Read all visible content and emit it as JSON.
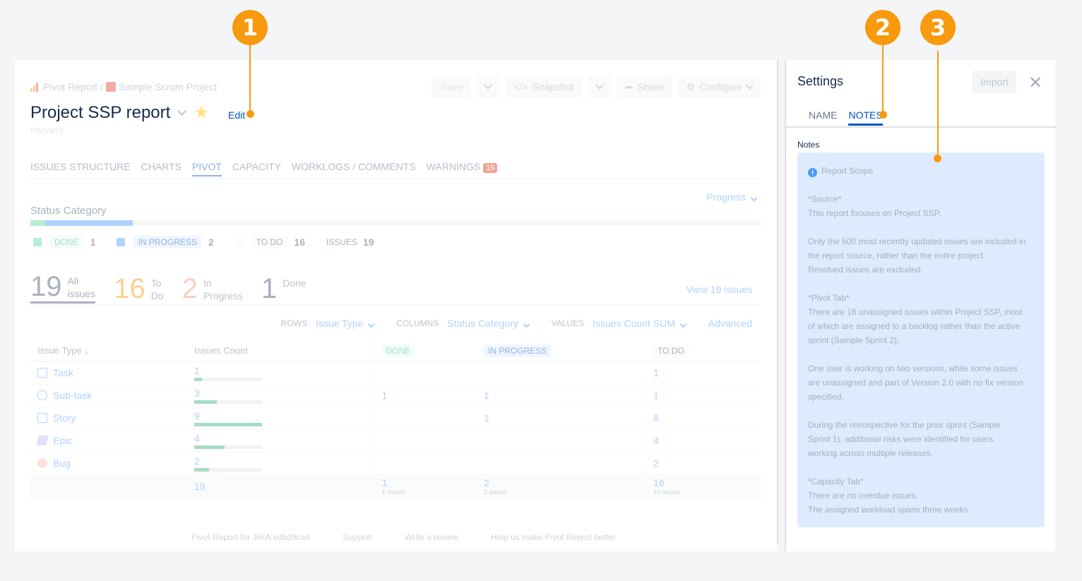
{
  "callouts": [
    "1",
    "2",
    "3"
  ],
  "breadcrumb": {
    "app": "Pivot Report",
    "sep": "/",
    "project": "Sample Scrum Project"
  },
  "toolbar": {
    "save": "Save",
    "snapshot": "Snapshot",
    "share": "Share",
    "configure": "Configure"
  },
  "report": {
    "title": "Project SSP report",
    "edit": "Edit",
    "visibility": "PRIVATE"
  },
  "tabs": [
    {
      "label": "ISSUES STRUCTURE"
    },
    {
      "label": "CHARTS"
    },
    {
      "label": "PIVOT"
    },
    {
      "label": "CAPACITY"
    },
    {
      "label": "WORKLOGS / COMMENTS"
    },
    {
      "label": "WARNINGS",
      "badge": "19"
    }
  ],
  "status": {
    "dropdown": "Progress",
    "title": "Status Category",
    "done_fraction": 0.053,
    "in_progress_fraction": 0.105,
    "legend": [
      {
        "label": "DONE",
        "count": "1",
        "color": "#57d9a3"
      },
      {
        "label": "IN PROGRESS",
        "count": "2",
        "color": "#4c9aff"
      },
      {
        "label": "TO DO",
        "count": "16",
        "color": "#dfe1e6"
      }
    ],
    "issues_label": "ISSUES",
    "issues_count": "19"
  },
  "summary": [
    {
      "num": "19",
      "l1": "All",
      "l2": "issues",
      "color": "#42526e"
    },
    {
      "num": "16",
      "l1": "To",
      "l2": "Do",
      "color": "#f79a0e"
    },
    {
      "num": "2",
      "l1": "In",
      "l2": "Progress",
      "color": "#ff8f73"
    },
    {
      "num": "1",
      "l1": "Done",
      "l2": "",
      "color": "#42526e"
    }
  ],
  "view_link": "View 19 issues",
  "pivot": {
    "rows_label": "ROWS",
    "rows_value": "Issue Type",
    "columns_label": "COLUMNS",
    "columns_value": "Status Category",
    "values_label": "VALUES",
    "values_value": "Issues Count SUM",
    "advanced": "Advanced"
  },
  "table": {
    "headers": [
      "Issue Type",
      "Issues Count",
      "DONE",
      "IN PROGRESS",
      "TO DO"
    ],
    "rows": [
      {
        "type": "Task",
        "icon": "task-icon",
        "count": "1",
        "frac": 0.11,
        "done": "",
        "inprog": "",
        "todo": "1"
      },
      {
        "type": "Sub-task",
        "icon": "subtask-icon",
        "count": "3",
        "frac": 0.33,
        "done": "1",
        "inprog": "1",
        "todo": "1"
      },
      {
        "type": "Story",
        "icon": "story-icon",
        "count": "9",
        "frac": 1.0,
        "done": "",
        "inprog": "1",
        "todo": "8"
      },
      {
        "type": "Epic",
        "icon": "epic-icon",
        "count": "4",
        "frac": 0.45,
        "done": "",
        "inprog": "",
        "todo": "4"
      },
      {
        "type": "Bug",
        "icon": "bug-icon",
        "count": "2",
        "frac": 0.22,
        "done": "",
        "inprog": "",
        "todo": "2"
      }
    ],
    "total": {
      "count": "19",
      "done": "1",
      "done_sub": "1 issues",
      "inprog": "2",
      "inprog_sub": "2 issues",
      "todo": "16",
      "todo_sub": "16 issues"
    }
  },
  "footer": [
    "Pivot Report for JIRA edbd9ca4",
    "Support",
    "Write a review",
    "Help us make Pivot Report better"
  ],
  "settings": {
    "title": "Settings",
    "import": "Import",
    "tabs": [
      "NAME",
      "NOTES"
    ],
    "notes_label": "Notes",
    "notes_heading": "Report Scope",
    "notes_paragraphs": [
      [
        "*Source*",
        "This report focuses on Project SSP."
      ],
      [
        "Only the 500 most recently updated issues are included in",
        "the report source, rather than the entire project.",
        "Resolved issues are excluded."
      ],
      [
        "*Pivot Tab*",
        "There are 16 unassigned issues within Project SSP, most",
        "of which are assigned to a backlog rather than the active",
        "sprint (Sample Sprint 2)."
      ],
      [
        "One user is working on two versions, while some issues",
        "are unassigned and part of Version 2.0 with no fix version",
        "specified."
      ],
      [
        "During the retrospective for the prior sprint (Sample",
        "Sprint 1), additional risks were identified for users",
        "working across multiple releases."
      ],
      [
        "*Capacity Tab*",
        "There are no overdue issues.",
        "The assigned workload spans three weeks."
      ]
    ]
  }
}
